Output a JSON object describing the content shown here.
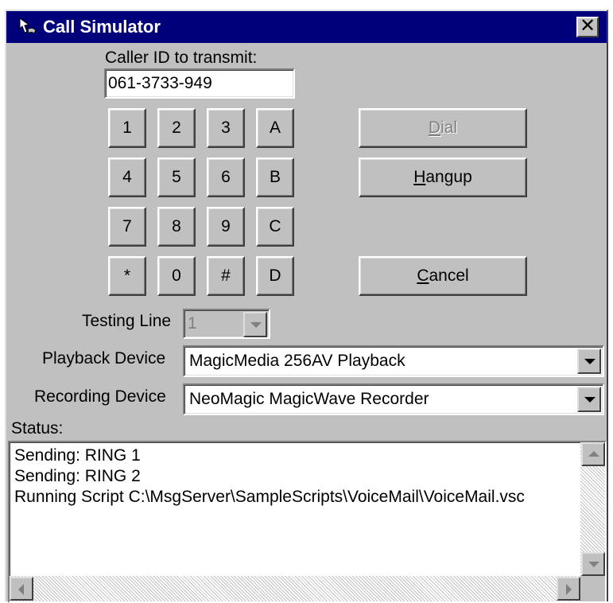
{
  "window": {
    "title": "Call Simulator",
    "close_label": "✕"
  },
  "caller_id": {
    "label": "Caller ID to transmit:",
    "value": "061-3733-949"
  },
  "keypad": {
    "rows": [
      [
        "1",
        "2",
        "3",
        "A"
      ],
      [
        "4",
        "5",
        "6",
        "B"
      ],
      [
        "7",
        "8",
        "9",
        "C"
      ],
      [
        "*",
        "0",
        "#",
        "D"
      ]
    ]
  },
  "buttons": {
    "dial": {
      "mnemonic": "D",
      "rest": "ial",
      "enabled": false
    },
    "hangup": {
      "mnemonic": "H",
      "rest": "angup",
      "enabled": true
    },
    "cancel": {
      "mnemonic": "C",
      "rest": "ancel",
      "enabled": true
    }
  },
  "testing_line": {
    "label": "Testing Line",
    "value": "1"
  },
  "playback_device": {
    "label": "Playback Device",
    "value": "MagicMedia 256AV Playback"
  },
  "recording_device": {
    "label": "Recording Device",
    "value": "NeoMagic MagicWave Recorder"
  },
  "status": {
    "label": "Status:",
    "lines": [
      "Sending: RING 1",
      "Sending: RING 2",
      "Running Script C:\\MsgServer\\SampleScripts\\VoiceMail\\VoiceMail.vsc"
    ]
  },
  "icons": {
    "app": "phone-cursor-icon",
    "close": "close-icon",
    "dropdown": "chevron-down-icon"
  }
}
